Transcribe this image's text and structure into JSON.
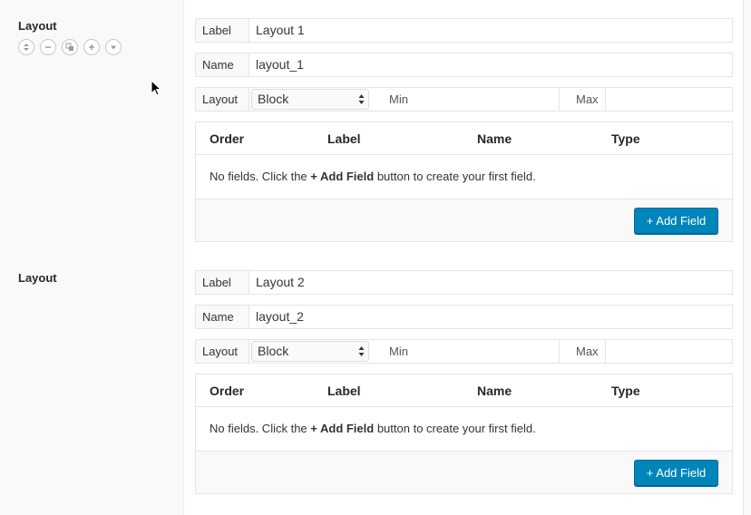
{
  "layouts": [
    {
      "heading": "Layout",
      "label_field": {
        "label": "Label",
        "value": "Layout 1"
      },
      "name_field": {
        "label": "Name",
        "value": "layout_1"
      },
      "layout_field": {
        "label": "Layout",
        "selected": "Block",
        "min_label": "Min",
        "max_label": "Max"
      },
      "table": {
        "columns": [
          "Order",
          "Label",
          "Name",
          "Type"
        ],
        "empty_prefix": "No fields. Click the ",
        "empty_bold": "+ Add Field",
        "empty_suffix": " button to create your first field.",
        "add_button": "+ Add Field"
      }
    },
    {
      "heading": "Layout",
      "label_field": {
        "label": "Label",
        "value": "Layout 2"
      },
      "name_field": {
        "label": "Name",
        "value": "layout_2"
      },
      "layout_field": {
        "label": "Layout",
        "selected": "Block",
        "min_label": "Min",
        "max_label": "Max"
      },
      "table": {
        "columns": [
          "Order",
          "Label",
          "Name",
          "Type"
        ],
        "empty_prefix": "No fields. Click the ",
        "empty_bold": "+ Add Field",
        "empty_suffix": " button to create your first field.",
        "add_button": "+ Add Field"
      }
    }
  ],
  "controls": [
    "reorder-icon",
    "remove-icon",
    "duplicate-icon",
    "add-icon",
    "collapse-icon"
  ],
  "colors": {
    "primary_button": "#0085ba",
    "border": "#e5e5e5"
  }
}
